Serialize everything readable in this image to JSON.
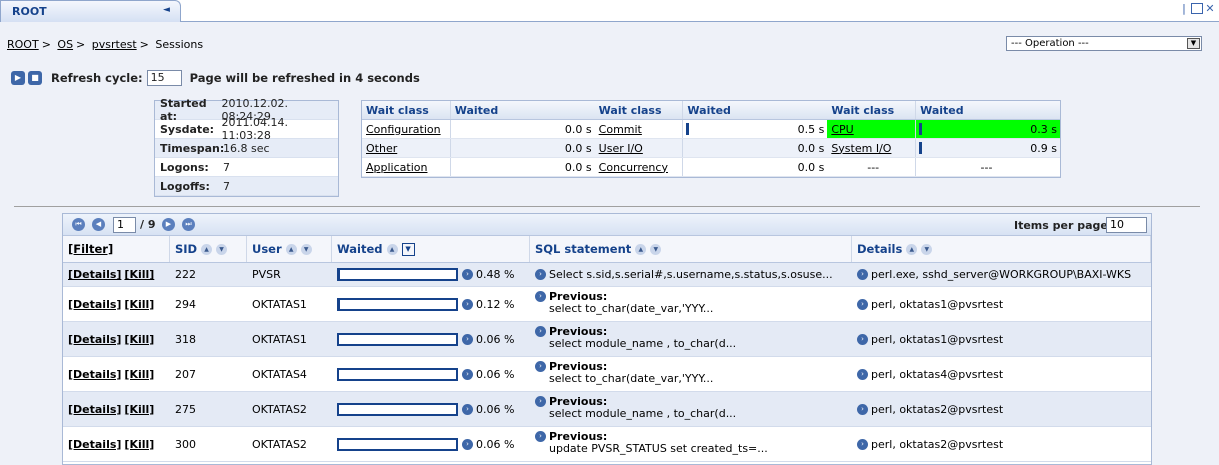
{
  "tab": {
    "title": "ROOT"
  },
  "breadcrumb": [
    "ROOT",
    "OS",
    "pvsrtest",
    "Sessions"
  ],
  "operation_select": {
    "value": "--- Operation ---"
  },
  "refresh": {
    "label": "Refresh cycle:",
    "value": "15",
    "status": "Page will be refreshed in 4 seconds"
  },
  "info": [
    {
      "key": "Started at:",
      "value": "2010.12.02. 08:24:29"
    },
    {
      "key": "Sysdate:",
      "value": "2011.04.14. 11:03:28"
    },
    {
      "key": "Timespan:",
      "value": "16.8 sec"
    },
    {
      "key": "Logons:",
      "value": "7"
    },
    {
      "key": "Logoffs:",
      "value": "7"
    }
  ],
  "wait": {
    "headers": [
      "Wait class",
      "Waited"
    ],
    "rows": [
      [
        {
          "name": "Configuration",
          "value": "0.0 s"
        },
        {
          "name": "Commit",
          "value": "0.5 s",
          "bar": true
        },
        {
          "name": "CPU",
          "value": "0.3 s",
          "bar": true,
          "highlight": true
        }
      ],
      [
        {
          "name": "Other",
          "value": "0.0 s"
        },
        {
          "name": "User I/O",
          "value": "0.0 s"
        },
        {
          "name": "System I/O",
          "value": "0.9 s",
          "bar": true
        }
      ],
      [
        {
          "name": "Application",
          "value": "0.0 s"
        },
        {
          "name": "Concurrency",
          "value": "0.0 s"
        },
        {
          "name": "---",
          "value": "---",
          "dash": true
        }
      ]
    ],
    "highlight_color": "#00ff00"
  },
  "pager": {
    "page": "1",
    "total": "/ 9",
    "items_label": "Items per page:",
    "items_value": "10"
  },
  "grid": {
    "headers": {
      "filter": "[Filter]",
      "sid": "SID",
      "user": "User",
      "waited": "Waited",
      "sql": "SQL statement",
      "details": "Details"
    },
    "rows": [
      {
        "details": "[Details]",
        "kill": "[Kill]",
        "sid": "222",
        "user": "PVSR",
        "waited_fraction": 0.0048,
        "waited": "0.48 %",
        "sql_title": "",
        "sql": "Select s.sid,s.serial#,s.username,s.status,s.osuse...",
        "info": "perl.exe, sshd_server@WORKGROUP\\BAXI-WKS"
      },
      {
        "details": "[Details]",
        "kill": "[Kill]",
        "sid": "294",
        "user": "OKTATAS1",
        "waited_fraction": 0.0012,
        "waited": "0.12 %",
        "sql_title": "Previous:",
        "sql": "select to_char(date_var,'YYY...",
        "info": "perl, oktatas1@pvsrtest"
      },
      {
        "details": "[Details]",
        "kill": "[Kill]",
        "sid": "318",
        "user": "OKTATAS1",
        "waited_fraction": 0.0006,
        "waited": "0.06 %",
        "sql_title": "Previous:",
        "sql": "select module_name , to_char(d...",
        "info": "perl, oktatas1@pvsrtest"
      },
      {
        "details": "[Details]",
        "kill": "[Kill]",
        "sid": "207",
        "user": "OKTATAS4",
        "waited_fraction": 0.0006,
        "waited": "0.06 %",
        "sql_title": "Previous:",
        "sql": "select to_char(date_var,'YYY...",
        "info": "perl, oktatas4@pvsrtest"
      },
      {
        "details": "[Details]",
        "kill": "[Kill]",
        "sid": "275",
        "user": "OKTATAS2",
        "waited_fraction": 0.0006,
        "waited": "0.06 %",
        "sql_title": "Previous:",
        "sql": "select module_name , to_char(d...",
        "info": "perl, oktatas2@pvsrtest"
      },
      {
        "details": "[Details]",
        "kill": "[Kill]",
        "sid": "300",
        "user": "OKTATAS2",
        "waited_fraction": 0.0006,
        "waited": "0.06 %",
        "sql_title": "Previous:",
        "sql": "update PVSR_STATUS set created_ts=...",
        "info": "perl, oktatas2@pvsrtest"
      }
    ]
  }
}
